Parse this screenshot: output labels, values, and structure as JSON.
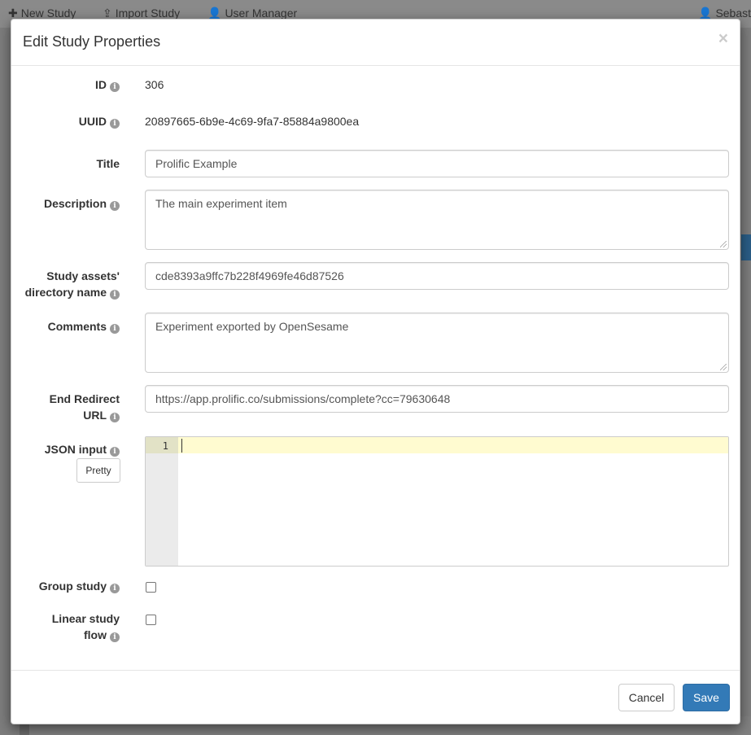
{
  "background": {
    "nav": {
      "new_study": "New Study",
      "import_study": "Import Study",
      "user_manager": "User Manager",
      "user": "Sebasti"
    }
  },
  "modal": {
    "title": "Edit Study Properties",
    "close": "×",
    "fields": {
      "id": {
        "label": "ID",
        "value": "306"
      },
      "uuid": {
        "label": "UUID",
        "value": "20897665-6b9e-4c69-9fa7-85884a9800ea"
      },
      "title": {
        "label": "Title",
        "value": "Prolific Example"
      },
      "description": {
        "label": "Description",
        "value": "The main experiment item"
      },
      "assets_dir": {
        "label_line1": "Study assets'",
        "label_line2": "directory name",
        "value": "cde8393a9ffc7b228f4969fe46d87526"
      },
      "comments": {
        "label": "Comments",
        "value": "Experiment exported by OpenSesame"
      },
      "end_redirect": {
        "label_line1": "End Redirect",
        "label_line2": "URL",
        "value": "https://app.prolific.co/submissions/complete?cc=79630648"
      },
      "json_input": {
        "label": "JSON input",
        "pretty_button": "Pretty",
        "line_number": "1"
      },
      "group_study": {
        "label": "Group study",
        "checked": false
      },
      "linear_flow": {
        "label_line1": "Linear study",
        "label_line2": "flow",
        "checked": false
      }
    },
    "footer": {
      "cancel": "Cancel",
      "save": "Save"
    }
  },
  "colors": {
    "primary": "#337ab7",
    "editor_active_line": "#fffbd0",
    "info_icon": "#999999"
  }
}
